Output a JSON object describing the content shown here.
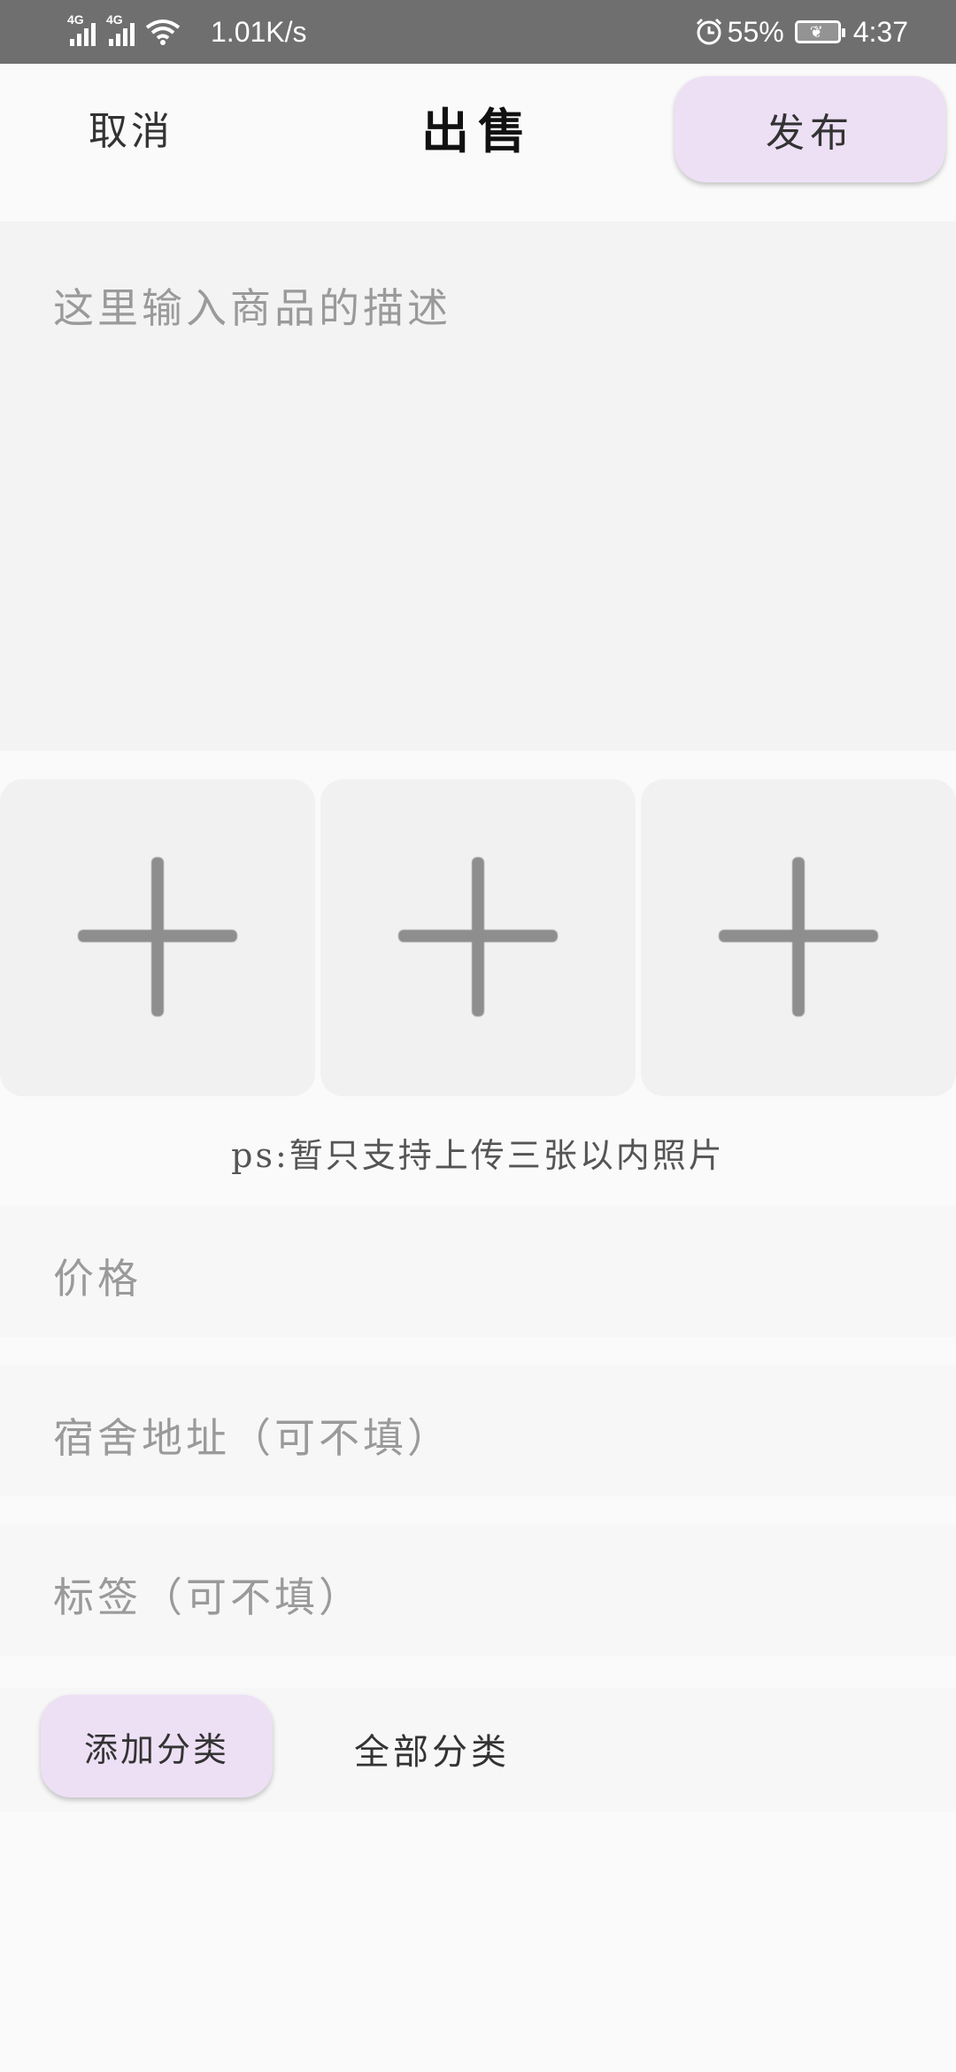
{
  "status_bar": {
    "network_1": "4G",
    "network_2": "4G",
    "net_speed": "1.01K/s",
    "battery_percent": "55%",
    "time": "4:37",
    "icons": [
      "signal-icon",
      "wifi-icon",
      "alarm-icon",
      "battery-icon"
    ]
  },
  "header": {
    "cancel_label": "取消",
    "title": "出售",
    "publish_label": "发布"
  },
  "description": {
    "placeholder": "这里输入商品的描述"
  },
  "photos": {
    "slots": [
      "add-photo-icon",
      "add-photo-icon",
      "add-photo-icon"
    ],
    "hint": "ps:暂只支持上传三张以内照片"
  },
  "fields": {
    "price_placeholder": "价格",
    "dorm_placeholder": "宿舍地址（可不填）",
    "tag_placeholder": "标签（可不填）"
  },
  "category": {
    "add_label": "添加分类",
    "all_label": "全部分类"
  },
  "colors": {
    "accent_button_bg": "#ede0f5",
    "status_bar_bg": "#6f6f6f",
    "placeholder_text": "#9a9a9a"
  }
}
